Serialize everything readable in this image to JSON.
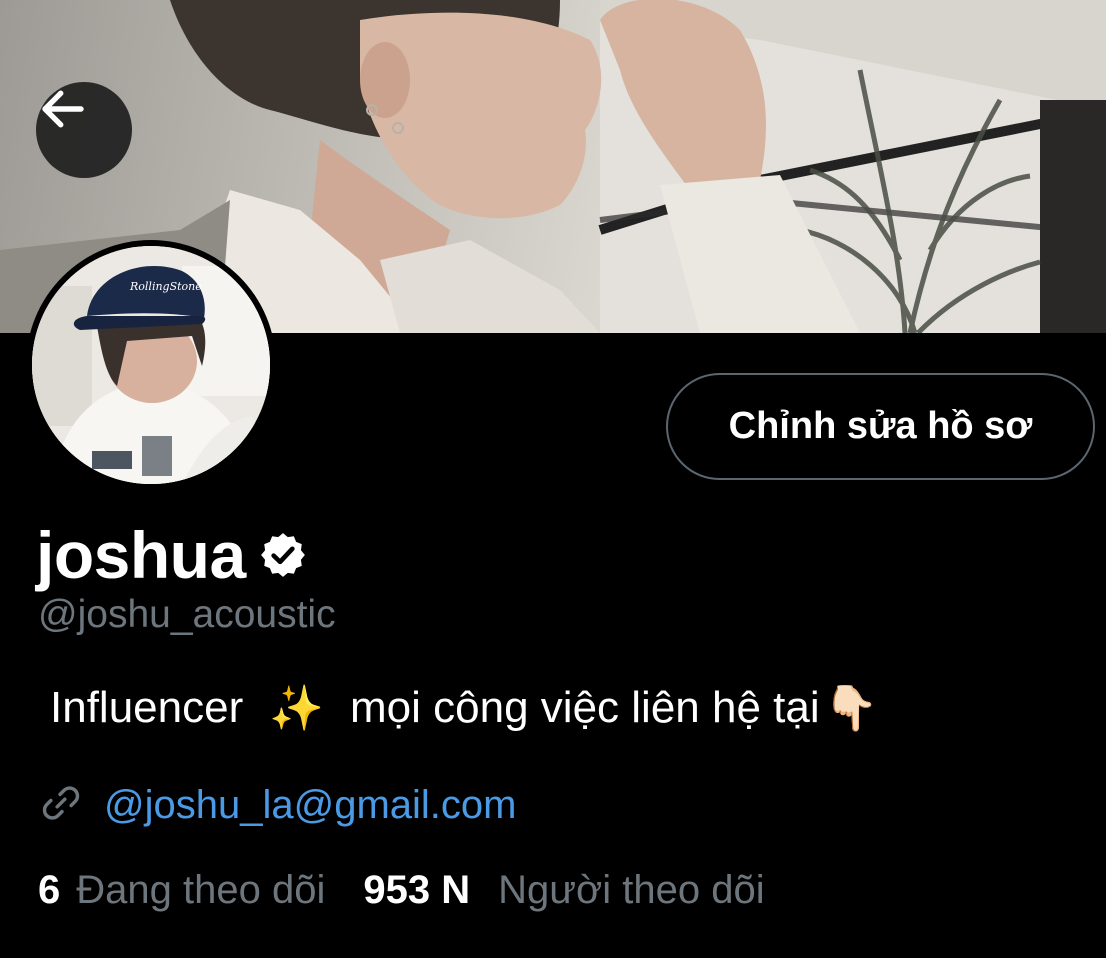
{
  "header": {
    "back_icon": "arrow-left-icon"
  },
  "profile": {
    "display_name": "joshua",
    "verified_icon": "verified-badge-icon",
    "handle": "@joshu_acoustic",
    "edit_button_label": "Chỉnh sửa hồ sơ",
    "bio": {
      "part1": "Influencer",
      "sparkle_icon": "✨",
      "part2": "mọi công việc liên hệ tại",
      "point_icon": "👇🏻"
    },
    "link": {
      "icon": "link-icon",
      "text": "@joshu_la@gmail.com"
    },
    "stats": {
      "following_count": "6",
      "following_label": "Đang theo dõi",
      "followers_count": "953 N",
      "followers_label": "Người theo dõi"
    }
  },
  "colors": {
    "background": "#000000",
    "muted_text": "#6e767d",
    "link": "#4a9ae6",
    "border": "#5b6670"
  }
}
